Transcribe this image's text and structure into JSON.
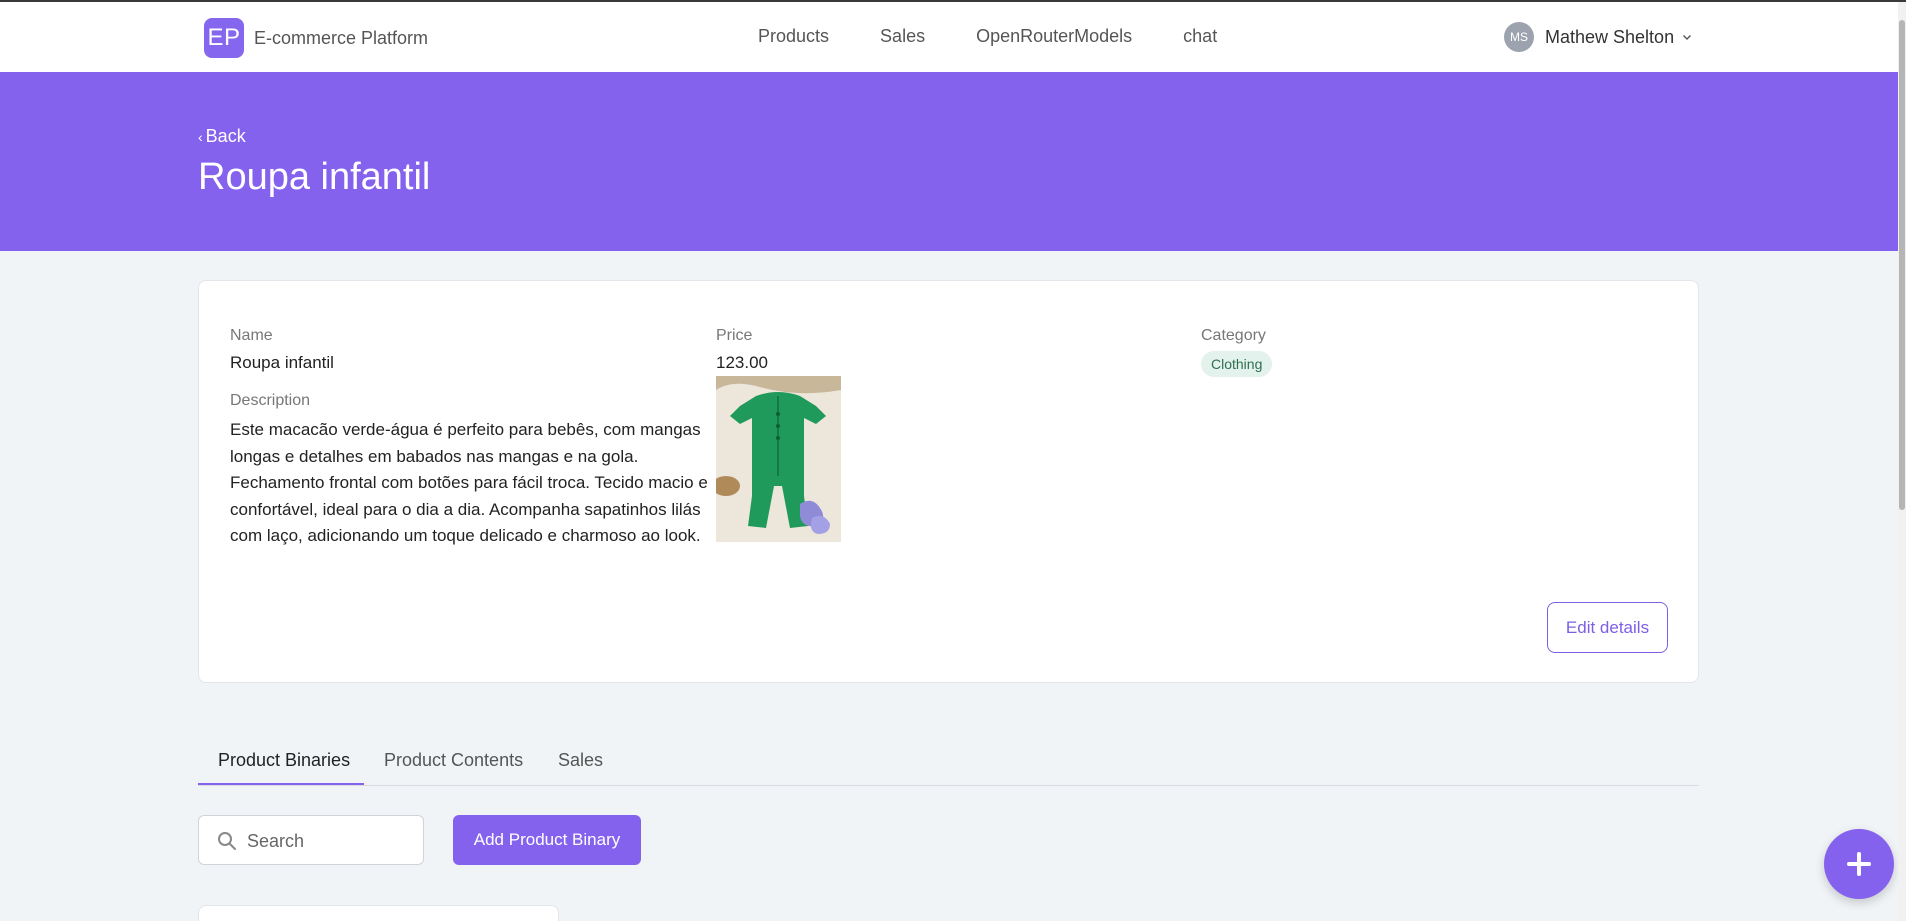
{
  "navbar": {
    "logo_text": "EP",
    "brand_name": "E-commerce Platform",
    "links": [
      "Products",
      "Sales",
      "OpenRouterModels",
      "chat"
    ],
    "user": {
      "initials": "MS",
      "name": "Mathew Shelton"
    }
  },
  "header": {
    "back_label": "Back",
    "title": "Roupa infantil"
  },
  "details": {
    "name_label": "Name",
    "name_value": "Roupa infantil",
    "description_label": "Description",
    "description_value": "Este macacão verde-água é perfeito para bebês, com mangas longas e detalhes em babados nas mangas e na gola. Fechamento frontal com botões para fácil troca. Tecido macio e confortável, ideal para o dia a dia. Acompanha sapatinhos lilás com laço, adicionando um toque delicado e charmoso ao look.",
    "price_label": "Price",
    "price_value": "123.00",
    "category_label": "Category",
    "category_value": "Clothing",
    "edit_label": "Edit details"
  },
  "tabs": [
    "Product Binaries",
    "Product Contents",
    "Sales"
  ],
  "active_tab": 0,
  "search": {
    "placeholder": "Search"
  },
  "add_button_label": "Add Product Binary",
  "colors": {
    "accent": "#8462ee",
    "badge_bg": "#e3f2ec",
    "badge_text": "#2f6f52"
  }
}
